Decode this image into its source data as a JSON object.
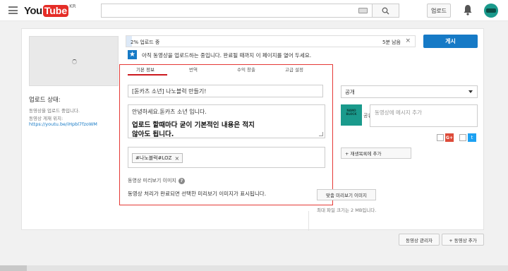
{
  "header": {
    "logo_you": "You",
    "logo_tube": "Tube",
    "logo_region": "KR",
    "upload_label": "업로드",
    "search_placeholder": ""
  },
  "sidebar": {
    "status_title": "업로드 상태:",
    "status_line1": "동영상을 업로드 중입니다.",
    "status_line2": "동영상 게재 위치:",
    "video_link": "https://youtu.be/iHpbl7fzoWM"
  },
  "upload": {
    "progress_text": "2% 업로드 중",
    "progress_percent": 2,
    "remaining": "5분 남음",
    "publish_label": "게시",
    "notice": "아직 동영상을 업로드하는 중입니다. 완료될 때까지 이 페이지를 열어 두세요."
  },
  "tabs": [
    {
      "label": "기본 정보"
    },
    {
      "label": "번역"
    },
    {
      "label": "수익 창출"
    },
    {
      "label": "고급 설정"
    }
  ],
  "form": {
    "title_value": "[돋카츠 소년] 나노블럭 만들기!",
    "description_line1": "안녕하세요.돋카츠 소년 입니다.",
    "description_line2": "업로드 할때마다 굳이 기본적인 내용은 적지",
    "description_line3": "않아도 됩니다.",
    "tag": "#나노블럭#LOZ",
    "tag_remove": "×",
    "thumbnail_label": "동영상 미리보기 이미지",
    "thumbnail_message": "동영상 처리가 완료되면 선택한 미리보기 이미지가 표시됩니다."
  },
  "right_panel": {
    "privacy": "공개",
    "share_thumb_text": "NANO\nBLOCK",
    "share_clip": "공유",
    "share_placeholder": "동영상에 메시지 추가",
    "gplus_label": "G+",
    "twitter_label": "t",
    "playlist_button": "+ 재생목록에 추가",
    "custom_thumb_button": "맞춤 미리보기 이미지",
    "max_size": "최대 파일 크기는 2 MB입니다."
  },
  "bottom": {
    "video_manager": "동영상 관리자",
    "add_video": "+ 동영상 추가"
  },
  "colors": {
    "brand_red": "#e52d27",
    "accent_blue": "#167ac6",
    "highlight_border": "#e53935",
    "channel_teal": "#1a9a8c"
  }
}
